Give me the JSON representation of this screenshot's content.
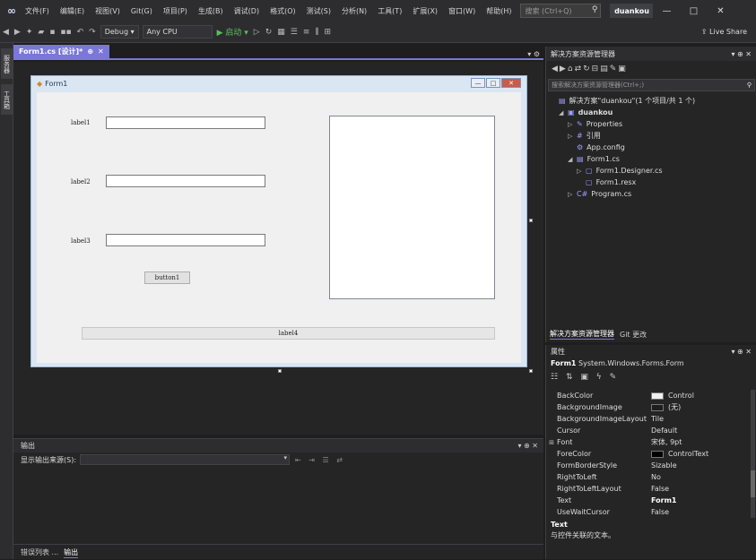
{
  "menubar": {
    "logo": "∞",
    "items": [
      "文件(F)",
      "编辑(E)",
      "视图(V)",
      "Git(G)",
      "项目(P)",
      "生成(B)",
      "调试(D)",
      "格式(O)",
      "测试(S)",
      "分析(N)",
      "工具(T)",
      "扩展(X)",
      "窗口(W)",
      "帮助(H)"
    ],
    "search_placeholder": "搜索 (Ctrl+Q)",
    "user": "duankou",
    "minimize": "—",
    "maximize": "□",
    "close": "✕"
  },
  "toolbar": {
    "config": "Debug ▾",
    "platform": "Any CPU",
    "run_label": "▶ 启动 ▾",
    "live_share": "Live Share"
  },
  "leftstrip": {
    "tabs": [
      "服务器",
      "工具箱"
    ]
  },
  "document": {
    "tab_title": "Form1.cs [设计]*",
    "tab_pin": "⊕",
    "tab_close": "✕",
    "tab_menu": "▾ ⚙"
  },
  "form": {
    "title": "Form1",
    "btn_min": "—",
    "btn_max": "□",
    "btn_close": "✕",
    "label1": "label1",
    "label2": "label2",
    "label3": "label3",
    "label4": "label4",
    "button1": "button1"
  },
  "output": {
    "title": "输出",
    "controls": "▾ ⊕ ✕",
    "source_label": "显示输出来源(S):",
    "tabs": [
      "错误列表 ...",
      "输出"
    ]
  },
  "solution_explorer": {
    "title": "解决方案资源管理器",
    "controls": "▾ ⊕ ✕",
    "search_placeholder": "搜索解决方案资源管理器(Ctrl+;)",
    "tree": [
      {
        "label": "解决方案\"duankou\"(1 个项目/共 1 个)",
        "indent": 0,
        "exp": "",
        "icon": "▤"
      },
      {
        "label": "duankou",
        "indent": 1,
        "exp": "◢",
        "icon": "▣",
        "bold": true
      },
      {
        "label": "Properties",
        "indent": 2,
        "exp": "▷",
        "icon": "✎"
      },
      {
        "label": "引用",
        "indent": 2,
        "exp": "▷",
        "icon": "#"
      },
      {
        "label": "App.config",
        "indent": 2,
        "exp": "",
        "icon": "⚙"
      },
      {
        "label": "Form1.cs",
        "indent": 2,
        "exp": "◢",
        "icon": "▤"
      },
      {
        "label": "Form1.Designer.cs",
        "indent": 3,
        "exp": "▷",
        "icon": "▢"
      },
      {
        "label": "Form1.resx",
        "indent": 3,
        "exp": "",
        "icon": "▢"
      },
      {
        "label": "Program.cs",
        "indent": 2,
        "exp": "▷",
        "icon": "C#"
      }
    ],
    "tabs": [
      "解决方案资源管理器",
      "Git 更改"
    ]
  },
  "properties": {
    "title": "属性",
    "controls": "▾ ⊕ ✕",
    "object_name": "Form1",
    "object_type": "System.Windows.Forms.Form",
    "rows": [
      {
        "name": "BackColor",
        "value": "Control",
        "swatch": "#f0f0f0",
        "exp": ""
      },
      {
        "name": "BackgroundImage",
        "value": "(无)",
        "swatch": "#1e1e1e",
        "exp": ""
      },
      {
        "name": "BackgroundImageLayout",
        "value": "Tile",
        "swatch": "",
        "exp": ""
      },
      {
        "name": "Cursor",
        "value": "Default",
        "swatch": "",
        "exp": ""
      },
      {
        "name": "Font",
        "value": "宋体, 9pt",
        "swatch": "",
        "exp": "⊞"
      },
      {
        "name": "ForeColor",
        "value": "ControlText",
        "swatch": "#000000",
        "exp": ""
      },
      {
        "name": "FormBorderStyle",
        "value": "Sizable",
        "swatch": "",
        "exp": ""
      },
      {
        "name": "RightToLeft",
        "value": "No",
        "swatch": "",
        "exp": ""
      },
      {
        "name": "RightToLeftLayout",
        "value": "False",
        "swatch": "",
        "exp": ""
      },
      {
        "name": "Text",
        "value": "Form1",
        "swatch": "",
        "exp": "",
        "bold": true
      },
      {
        "name": "UseWaitCursor",
        "value": "False",
        "swatch": "",
        "exp": ""
      }
    ],
    "desc_title": "Text",
    "desc_text": "与控件关联的文本。"
  }
}
